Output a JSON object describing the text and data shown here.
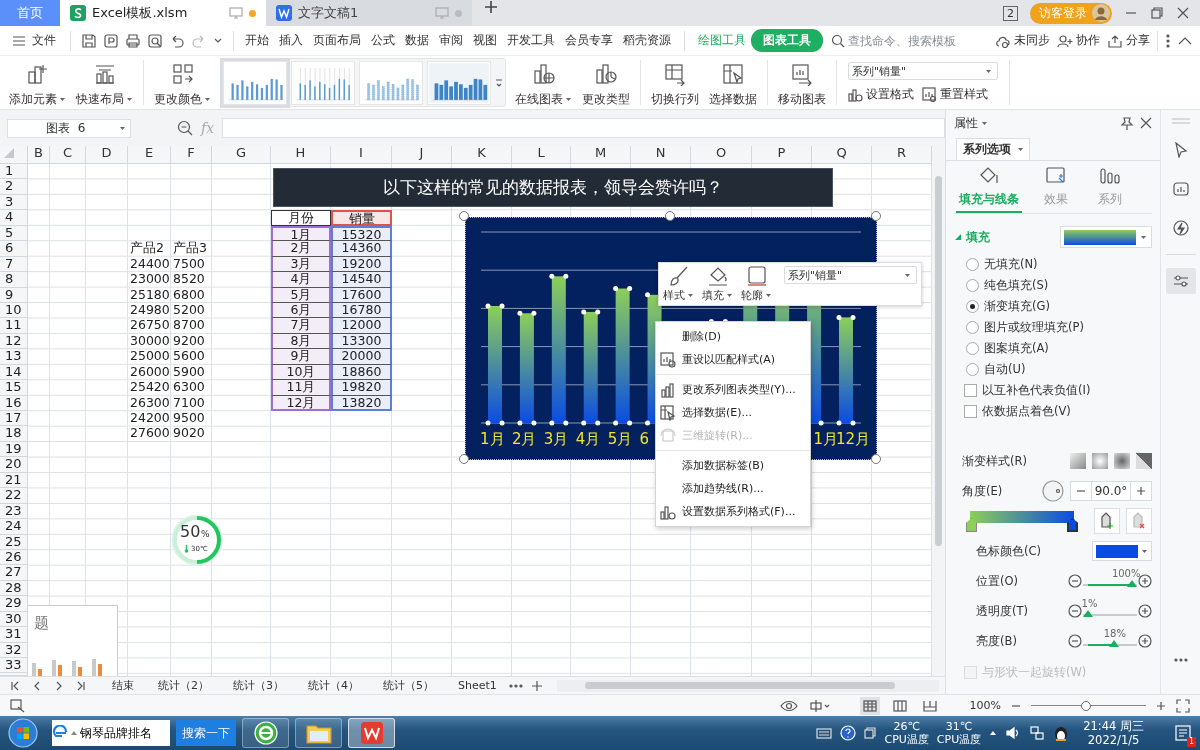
{
  "tabs": [
    {
      "label": "首页",
      "kind": "home",
      "selected": false
    },
    {
      "label": "Excel模板.xlsm",
      "kind": "sheet",
      "selected": true
    },
    {
      "label": "文字文稿1",
      "kind": "doc",
      "selected": false
    }
  ],
  "title_bar": {
    "window_count": "2",
    "login": "访客登录"
  },
  "menu": {
    "file": "文件",
    "tabs": [
      {
        "label": "开始",
        "kind": "plain",
        "selected": false
      },
      {
        "label": "插入",
        "kind": "plain",
        "selected": false
      },
      {
        "label": "页面布局",
        "kind": "plain",
        "selected": false
      },
      {
        "label": "公式",
        "kind": "plain",
        "selected": false
      },
      {
        "label": "数据",
        "kind": "plain",
        "selected": false
      },
      {
        "label": "审阅",
        "kind": "plain",
        "selected": false
      },
      {
        "label": "视图",
        "kind": "plain",
        "selected": false
      },
      {
        "label": "开发工具",
        "kind": "plain",
        "selected": false
      },
      {
        "label": "会员专享",
        "kind": "plain",
        "selected": false
      },
      {
        "label": "稻壳资源",
        "kind": "plain",
        "selected": false
      },
      {
        "label": "绘图工具",
        "kind": "tool",
        "selected": false
      },
      {
        "label": "图表工具",
        "kind": "tool",
        "selected": true
      }
    ],
    "search": {
      "placeholder": "查找命令、搜索模板"
    },
    "actions": [
      "未同步",
      "协作",
      "分享"
    ]
  },
  "ribbon": {
    "buttons_left": [
      {
        "label": "添加元素",
        "dropdown": true
      },
      {
        "label": "快速布局",
        "dropdown": true
      },
      {
        "label": "更改颜色",
        "dropdown": true
      }
    ],
    "styles": [
      {
        "kind": "plain",
        "selected": true
      },
      {
        "kind": "lined",
        "selected": false
      },
      {
        "kind": "dotted",
        "selected": false
      },
      {
        "kind": "shaded",
        "selected": false
      }
    ],
    "buttons_right": [
      {
        "label": "在线图表",
        "dropdown": true
      },
      {
        "label": "更改类型",
        "dropdown": false
      },
      {
        "label": "切换行列",
        "dropdown": false
      },
      {
        "label": "选择数据",
        "dropdown": false
      },
      {
        "label": "移动图表",
        "dropdown": false
      }
    ],
    "series_select": "系列\"销量\"",
    "small_buttons": [
      "设置格式",
      "重置样式"
    ]
  },
  "formula_bar": {
    "name_box": "图表  6",
    "fx": "fx"
  },
  "sheet": {
    "columns": [
      "B",
      "C",
      "D",
      "E",
      "F",
      "G",
      "H",
      "I",
      "J",
      "K",
      "L",
      "M",
      "N",
      "O",
      "P",
      "Q",
      "R"
    ],
    "rows": [
      "1",
      "2",
      "3",
      "4",
      "5",
      "6",
      "7",
      "8",
      "9",
      "10",
      "11",
      "12",
      "13",
      "14",
      "15",
      "16",
      "17",
      "18",
      "19",
      "20",
      "21",
      "22",
      "23",
      "24",
      "25",
      "26",
      "27",
      "28",
      "29",
      "30",
      "31",
      "32",
      "33"
    ],
    "product_table": {
      "headers": [
        "产品2",
        "产品3"
      ],
      "rows": [
        [
          "24400",
          "7500"
        ],
        [
          "23000",
          "8520"
        ],
        [
          "25180",
          "6800"
        ],
        [
          "24980",
          "5200"
        ],
        [
          "26750",
          "8700"
        ],
        [
          "30000",
          "9200"
        ],
        [
          "25000",
          "5600"
        ],
        [
          "26000",
          "5900"
        ],
        [
          "25420",
          "6300"
        ],
        [
          "26300",
          "7100"
        ],
        [
          "24200",
          "9500"
        ],
        [
          "27600",
          "9020"
        ]
      ]
    },
    "sales_table": {
      "headers": [
        "月份",
        "销量"
      ],
      "rows": [
        [
          "1月",
          "15320"
        ],
        [
          "2月",
          "14360"
        ],
        [
          "3月",
          "19200"
        ],
        [
          "4月",
          "14540"
        ],
        [
          "5月",
          "17600"
        ],
        [
          "6月",
          "16780"
        ],
        [
          "7月",
          "12000"
        ],
        [
          "8月",
          "13300"
        ],
        [
          "9月",
          "20000"
        ],
        [
          "10月",
          "18860"
        ],
        [
          "11月",
          "19820"
        ],
        [
          "12月",
          "13820"
        ]
      ]
    },
    "banner": "以下这样的常见的数据报表，领导会赞许吗？",
    "chart": {
      "labels_start": [
        "1月",
        "2月",
        "3月",
        "4月",
        "5月",
        "6"
      ],
      "labels_end": [
        "1月",
        "12月"
      ]
    },
    "mini_toolbar": {
      "buttons": [
        "样式",
        "填充",
        "轮廓"
      ],
      "series_select": "系列\"销量\""
    },
    "context_menu": [
      {
        "kind": "plain",
        "label": "删除(D)",
        "disabled": false
      },
      {
        "kind": "reset",
        "label": "重设以匹配样式(A)",
        "disabled": false
      },
      {
        "kind": "separator"
      },
      {
        "kind": "chart-type",
        "label": "更改系列图表类型(Y)...",
        "disabled": false
      },
      {
        "kind": "select-data",
        "label": "选择数据(E)...",
        "disabled": false
      },
      {
        "kind": "rotate",
        "label": "三维旋转(R)...",
        "disabled": true
      },
      {
        "kind": "separator"
      },
      {
        "kind": "plain",
        "label": "添加数据标签(B)",
        "disabled": false
      },
      {
        "kind": "plain",
        "label": "添加趋势线(R)...",
        "disabled": false
      },
      {
        "kind": "format",
        "label": "设置数据系列格式(F)...",
        "disabled": false
      }
    ],
    "gauge": {
      "value": "50",
      "unit": "%",
      "temperature": "30℃",
      "level": 0.5
    },
    "thumbnail": {
      "title": "题"
    }
  },
  "sheet_tabs": [
    {
      "label": "结束",
      "selected": false
    },
    {
      "label": "统计（2）",
      "selected": false
    },
    {
      "label": "统计（3）",
      "selected": false
    },
    {
      "label": "统计（4）",
      "selected": false
    },
    {
      "label": "统计（5）",
      "selected": false
    },
    {
      "label": "Sheet1",
      "selected": false
    }
  ],
  "status_bar": {
    "views": [
      {
        "selected": true
      },
      {
        "selected": false
      },
      {
        "selected": false
      }
    ],
    "zoom": "100%",
    "zoom_slider": {
      "level": 0.48
    }
  },
  "panel": {
    "title": "属性",
    "tab": "系列选项",
    "icon_tabs": [
      {
        "label": "填充与线条",
        "selected": true
      },
      {
        "label": "效果",
        "selected": false
      },
      {
        "label": "系列",
        "selected": false
      }
    ],
    "section": "填充",
    "expanded": true,
    "fill_options": [
      {
        "label": "无填充(N)",
        "selected": false
      },
      {
        "label": "纯色填充(S)",
        "selected": false
      },
      {
        "label": "渐变填充(G)",
        "selected": true
      },
      {
        "label": "图片或纹理填充(P)",
        "selected": false
      },
      {
        "label": "图案填充(A)",
        "selected": false
      },
      {
        "label": "自动(U)",
        "selected": false
      }
    ],
    "checks": [
      {
        "label": "以互补色代表负值(I)",
        "checked": false,
        "disabled": false
      },
      {
        "label": "依数据点着色(V)",
        "checked": false,
        "disabled": false
      }
    ],
    "gradient_style": "渐变样式(R)",
    "angle_label": "角度(E)",
    "angle": "90.0°",
    "stops": [
      {
        "color": "#8dcf58",
        "selected": false
      },
      {
        "color": "#0a4ce3",
        "selected": true
      }
    ],
    "stop_color_label": "色标颜色(C)",
    "sliders": [
      {
        "label": "位置(O)",
        "reading": "100%",
        "level": 1
      },
      {
        "label": "透明度(T)",
        "reading": "1%",
        "level": 0.01
      },
      {
        "label": "亮度(B)",
        "reading": "18%",
        "level": 0.59
      }
    ],
    "rotate": {
      "label": "与形状一起旋转(W)",
      "checked": false,
      "disabled": true
    }
  },
  "side_tools": [
    {
      "selected": false
    },
    {
      "selected": false
    },
    {
      "selected": false
    },
    {
      "selected": true
    }
  ],
  "taskbar": {
    "search_value": "钢琴品牌排名",
    "search_button": "搜索一下",
    "apps": [
      {
        "kind": "browser",
        "selected": false
      },
      {
        "kind": "folder",
        "selected": false
      },
      {
        "kind": "wps",
        "selected": true
      }
    ],
    "temps": [
      {
        "value": "26℃",
        "label": "CPU温度"
      },
      {
        "value": "31℃",
        "label": "CPU温度"
      }
    ],
    "time": "21:44 周三",
    "date": "2022/1/5",
    "notifications": "1"
  }
}
